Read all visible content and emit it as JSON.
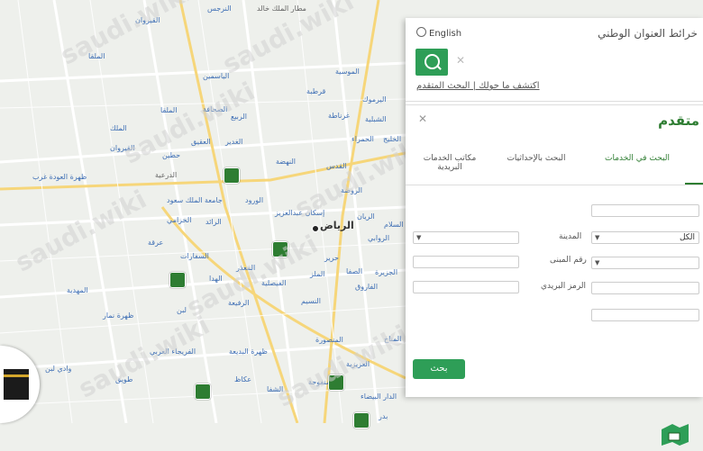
{
  "header": {
    "lang_label": "English",
    "title": "خرائط العنوان الوطني",
    "search_placeholder": "",
    "explore_link": "اكتشف ما حولك | البحث المتقدم"
  },
  "advanced": {
    "title": "متقدم",
    "tabs": [
      {
        "label": "البحث في الخدمات"
      },
      {
        "label": "البحث بالإحداثيات"
      },
      {
        "label": "مكاتب الخدمات البريدية"
      }
    ],
    "region_value": "الكل",
    "city_label": "المدينة",
    "building_label": "رقم المبنى",
    "postal_label": "الرمز البريدي",
    "find_label": "بحث"
  },
  "map": {
    "labels": [
      "النرجس",
      "مطار الملك خالد",
      "القيروان",
      "الملقا",
      "الياسمين",
      "الصحافة",
      "الربيع",
      "الملقا",
      "الموسية",
      "قرطبة",
      "غرناطة",
      "اليرموك",
      "الشبلية",
      "الملك",
      "القيروان",
      "العقيق",
      "الغدير",
      "حطين",
      "الخليج",
      "الحمراء",
      "النهضة",
      "القدس",
      "الروضة",
      "الريان",
      "ظهرة العودة غرب",
      "الدرعية",
      "جامعة الملك سعود",
      "الورود",
      "الخزامي",
      "الرائد",
      "الرياض",
      "إسكان عبدالعزيز",
      "عرقة",
      "السفارات",
      "السلام",
      "الروابي",
      "المعذر",
      "حرير",
      "الصفا",
      "الجزيرة",
      "المهدية",
      "لبن",
      "الهدا",
      "الملز",
      "الفاروق",
      "ظهرة نمار",
      "الفيصلية",
      "الرفيعة",
      "النسيم",
      "الفريجاء العربي",
      "ظهرة البديعة",
      "المنصورة",
      "المناخ",
      "وادي لبن",
      "طويق",
      "العزيزية",
      "الشفا",
      "الدار البيضاء",
      "عكاظ",
      "منفوحة",
      "بدر"
    ]
  }
}
